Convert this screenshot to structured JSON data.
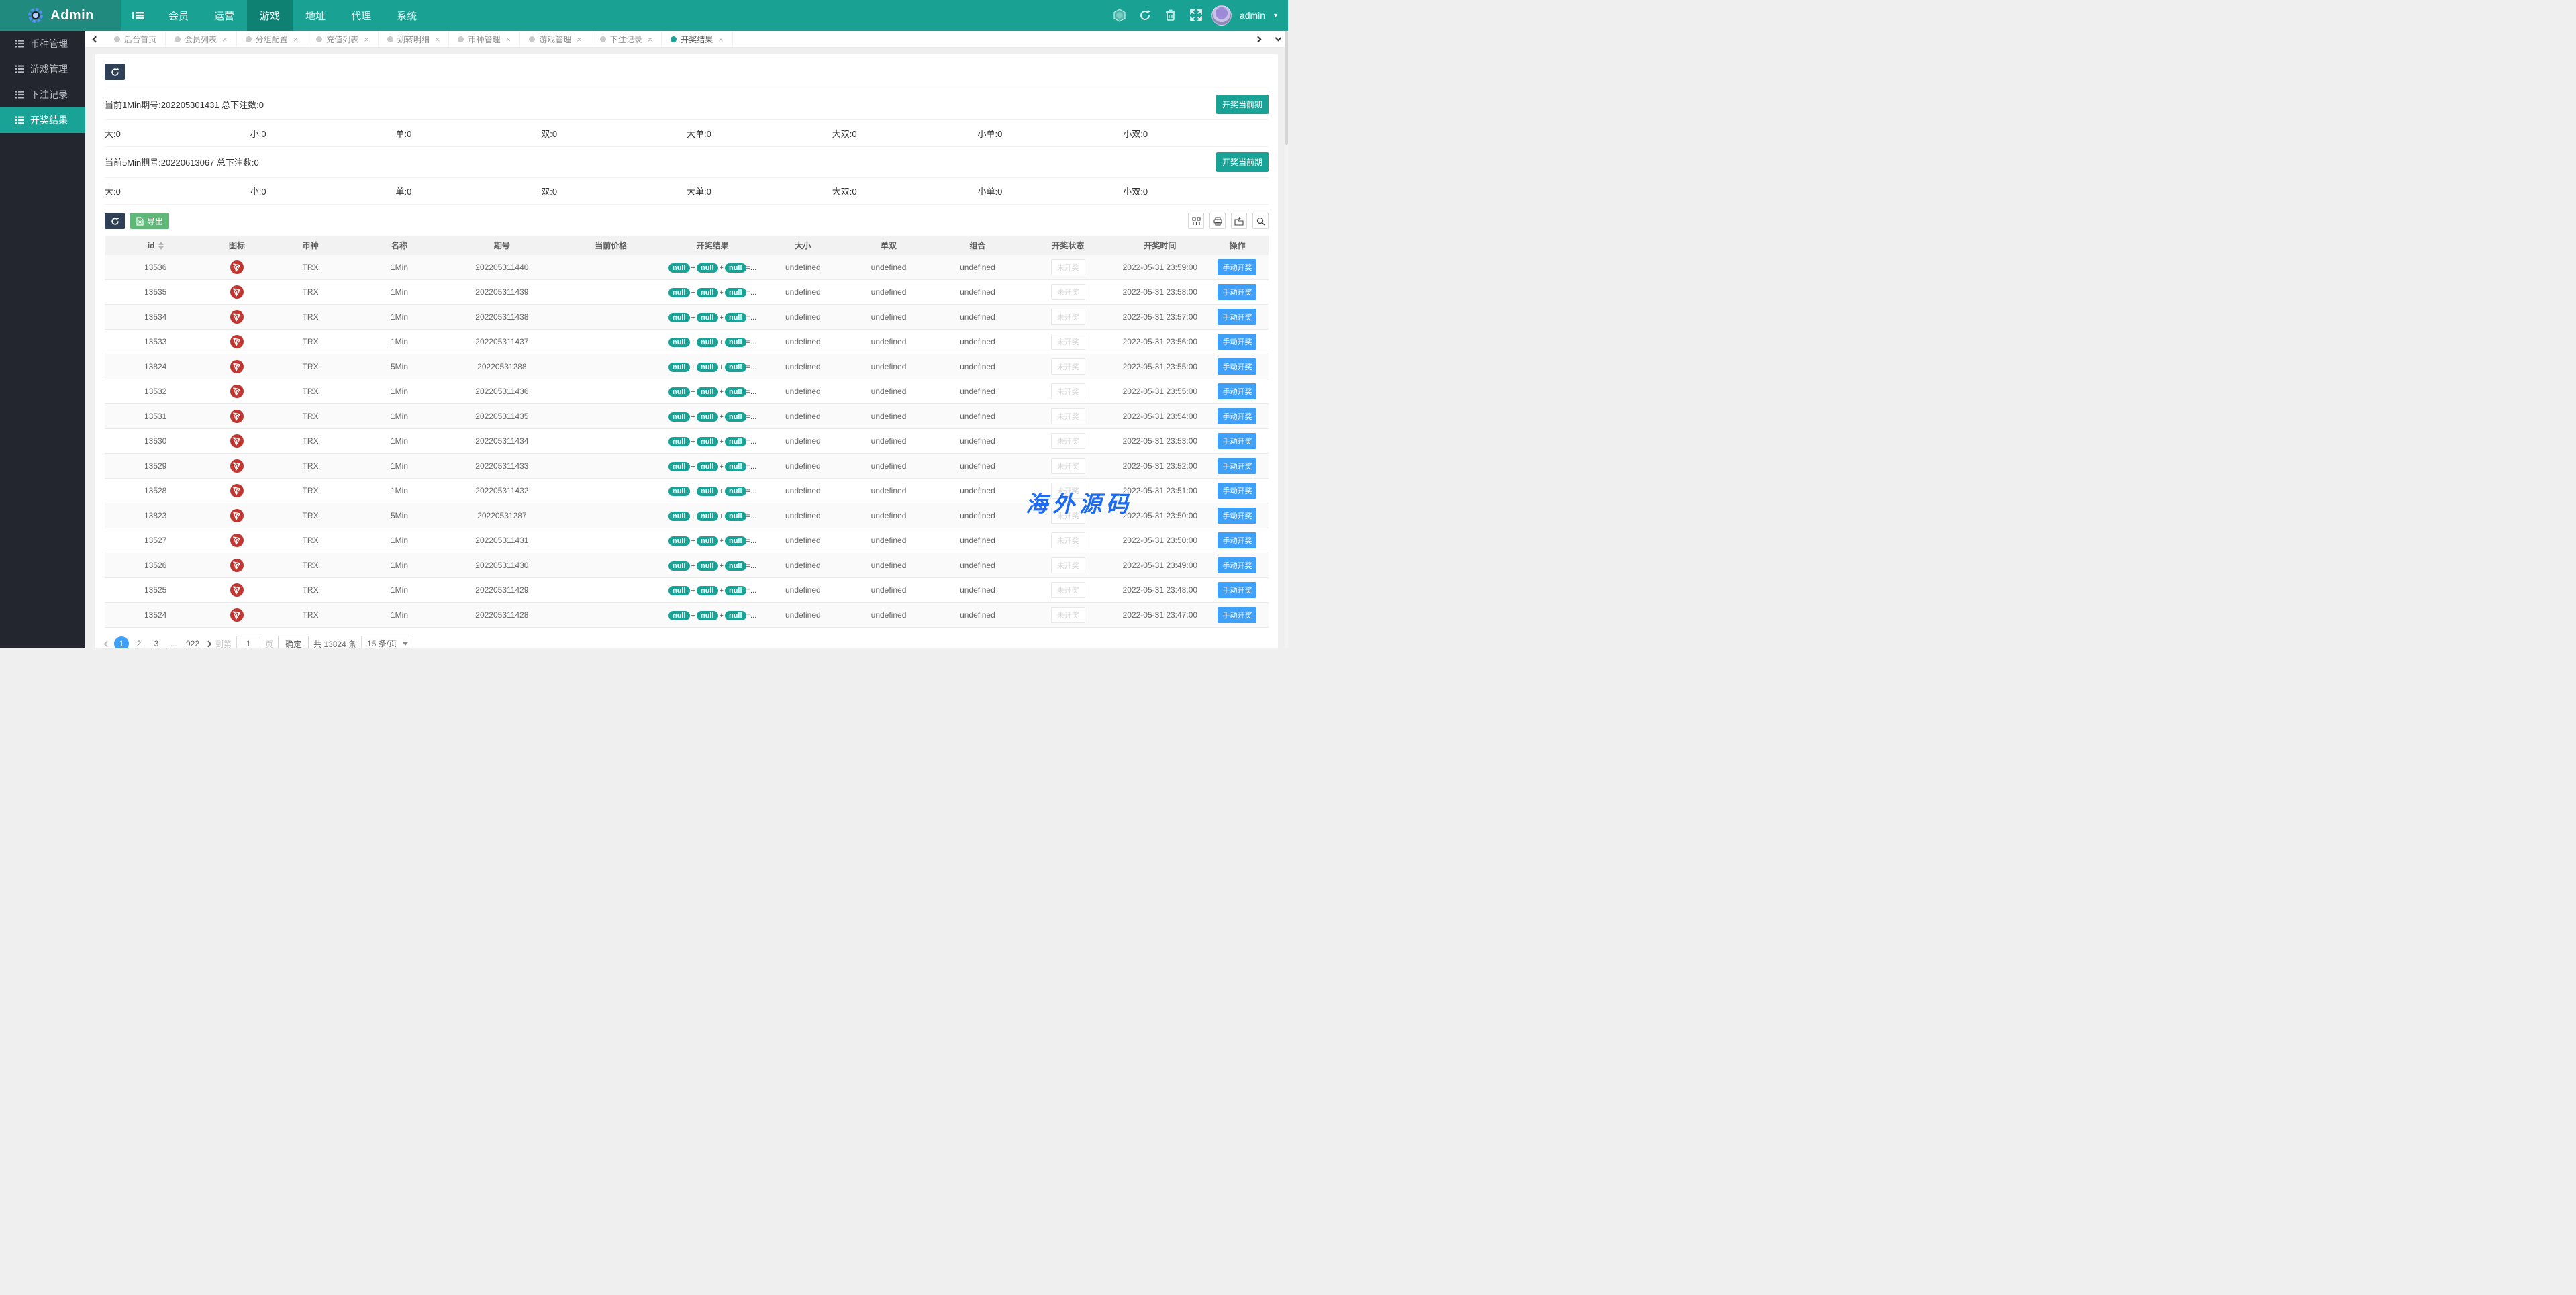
{
  "colors": {
    "theme_teal": "#18A396",
    "header_teal": "#19A294",
    "dark_button": "#2F4056",
    "green_button": "#5FB878",
    "blue_button": "#3FA0F8",
    "coin_red": "#C23631",
    "watermark_blue": "#1E6BF2"
  },
  "header": {
    "logo_text": "Admin",
    "nav": [
      {
        "label": "会员"
      },
      {
        "label": "运营"
      },
      {
        "label": "游戏",
        "active": true
      },
      {
        "label": "地址"
      },
      {
        "label": "代理"
      },
      {
        "label": "系统"
      }
    ],
    "icons": [
      "hexagon-badge",
      "refresh",
      "trash",
      "fullscreen"
    ],
    "username": "admin"
  },
  "sidebar": {
    "items": [
      {
        "label": "币种管理"
      },
      {
        "label": "游戏管理"
      },
      {
        "label": "下注记录"
      },
      {
        "label": "开奖结果",
        "active": true
      }
    ]
  },
  "tabs": {
    "items": [
      {
        "label": "后台首页",
        "closable": false
      },
      {
        "label": "会员列表",
        "closable": true
      },
      {
        "label": "分组配置",
        "closable": true
      },
      {
        "label": "充值列表",
        "closable": true
      },
      {
        "label": "划转明细",
        "closable": true
      },
      {
        "label": "币种管理",
        "closable": true
      },
      {
        "label": "游戏管理",
        "closable": true
      },
      {
        "label": "下注记录",
        "closable": true
      },
      {
        "label": "开奖结果",
        "closable": true,
        "active": true
      }
    ]
  },
  "sections": [
    {
      "title": "当前1Min期号:202205301431 总下注数:0",
      "button_label": "开奖当前期",
      "stats": [
        "大:0",
        "小:0",
        "单:0",
        "双:0",
        "大单:0",
        "大双:0",
        "小单:0",
        "小双:0"
      ]
    },
    {
      "title": "当前5Min期号:20220613067 总下注数:0",
      "button_label": "开奖当前期",
      "stats": [
        "大:0",
        "小:0",
        "单:0",
        "双:0",
        "大单:0",
        "大双:0",
        "小单:0",
        "小双:0"
      ]
    }
  ],
  "toolbar": {
    "export_label": "导出",
    "table_tools": [
      "layout-columns",
      "print",
      "export-file",
      "search"
    ]
  },
  "table": {
    "columns": [
      "id",
      "图标",
      "币种",
      "名称",
      "期号",
      "当前价格",
      "开奖结果",
      "大小",
      "单双",
      "组合",
      "开奖状态",
      "开奖时间",
      "操作"
    ],
    "rows": [
      {
        "id": "13536",
        "coin": "TRX",
        "name": "1Min",
        "issue": "202205311440",
        "price": "",
        "result": [
          "null",
          "null",
          "null"
        ],
        "result_suffix": "=...",
        "bigsmall": "undefined",
        "oddeven": "undefined",
        "combo": "undefined",
        "status": "未开奖",
        "time": "2022-05-31 23:59:00",
        "action": "手动开奖"
      },
      {
        "id": "13535",
        "coin": "TRX",
        "name": "1Min",
        "issue": "202205311439",
        "price": "",
        "result": [
          "null",
          "null",
          "null"
        ],
        "result_suffix": "=...",
        "bigsmall": "undefined",
        "oddeven": "undefined",
        "combo": "undefined",
        "status": "未开奖",
        "time": "2022-05-31 23:58:00",
        "action": "手动开奖"
      },
      {
        "id": "13534",
        "coin": "TRX",
        "name": "1Min",
        "issue": "202205311438",
        "price": "",
        "result": [
          "null",
          "null",
          "null"
        ],
        "result_suffix": "=...",
        "bigsmall": "undefined",
        "oddeven": "undefined",
        "combo": "undefined",
        "status": "未开奖",
        "time": "2022-05-31 23:57:00",
        "action": "手动开奖"
      },
      {
        "id": "13533",
        "coin": "TRX",
        "name": "1Min",
        "issue": "202205311437",
        "price": "",
        "result": [
          "null",
          "null",
          "null"
        ],
        "result_suffix": "=...",
        "bigsmall": "undefined",
        "oddeven": "undefined",
        "combo": "undefined",
        "status": "未开奖",
        "time": "2022-05-31 23:56:00",
        "action": "手动开奖"
      },
      {
        "id": "13824",
        "coin": "TRX",
        "name": "5Min",
        "issue": "20220531288",
        "price": "",
        "result": [
          "null",
          "null",
          "null"
        ],
        "result_suffix": "=...",
        "bigsmall": "undefined",
        "oddeven": "undefined",
        "combo": "undefined",
        "status": "未开奖",
        "time": "2022-05-31 23:55:00",
        "action": "手动开奖"
      },
      {
        "id": "13532",
        "coin": "TRX",
        "name": "1Min",
        "issue": "202205311436",
        "price": "",
        "result": [
          "null",
          "null",
          "null"
        ],
        "result_suffix": "=...",
        "bigsmall": "undefined",
        "oddeven": "undefined",
        "combo": "undefined",
        "status": "未开奖",
        "time": "2022-05-31 23:55:00",
        "action": "手动开奖"
      },
      {
        "id": "13531",
        "coin": "TRX",
        "name": "1Min",
        "issue": "202205311435",
        "price": "",
        "result": [
          "null",
          "null",
          "null"
        ],
        "result_suffix": "=...",
        "bigsmall": "undefined",
        "oddeven": "undefined",
        "combo": "undefined",
        "status": "未开奖",
        "time": "2022-05-31 23:54:00",
        "action": "手动开奖"
      },
      {
        "id": "13530",
        "coin": "TRX",
        "name": "1Min",
        "issue": "202205311434",
        "price": "",
        "result": [
          "null",
          "null",
          "null"
        ],
        "result_suffix": "=...",
        "bigsmall": "undefined",
        "oddeven": "undefined",
        "combo": "undefined",
        "status": "未开奖",
        "time": "2022-05-31 23:53:00",
        "action": "手动开奖"
      },
      {
        "id": "13529",
        "coin": "TRX",
        "name": "1Min",
        "issue": "202205311433",
        "price": "",
        "result": [
          "null",
          "null",
          "null"
        ],
        "result_suffix": "=...",
        "bigsmall": "undefined",
        "oddeven": "undefined",
        "combo": "undefined",
        "status": "未开奖",
        "time": "2022-05-31 23:52:00",
        "action": "手动开奖"
      },
      {
        "id": "13528",
        "coin": "TRX",
        "name": "1Min",
        "issue": "202205311432",
        "price": "",
        "result": [
          "null",
          "null",
          "null"
        ],
        "result_suffix": "=...",
        "bigsmall": "undefined",
        "oddeven": "undefined",
        "combo": "undefined",
        "status": "未开奖",
        "time": "2022-05-31 23:51:00",
        "action": "手动开奖"
      },
      {
        "id": "13823",
        "coin": "TRX",
        "name": "5Min",
        "issue": "20220531287",
        "price": "",
        "result": [
          "null",
          "null",
          "null"
        ],
        "result_suffix": "=...",
        "bigsmall": "undefined",
        "oddeven": "undefined",
        "combo": "undefined",
        "status": "未开奖",
        "time": "2022-05-31 23:50:00",
        "action": "手动开奖"
      },
      {
        "id": "13527",
        "coin": "TRX",
        "name": "1Min",
        "issue": "202205311431",
        "price": "",
        "result": [
          "null",
          "null",
          "null"
        ],
        "result_suffix": "=...",
        "bigsmall": "undefined",
        "oddeven": "undefined",
        "combo": "undefined",
        "status": "未开奖",
        "time": "2022-05-31 23:50:00",
        "action": "手动开奖"
      },
      {
        "id": "13526",
        "coin": "TRX",
        "name": "1Min",
        "issue": "202205311430",
        "price": "",
        "result": [
          "null",
          "null",
          "null"
        ],
        "result_suffix": "=...",
        "bigsmall": "undefined",
        "oddeven": "undefined",
        "combo": "undefined",
        "status": "未开奖",
        "time": "2022-05-31 23:49:00",
        "action": "手动开奖"
      },
      {
        "id": "13525",
        "coin": "TRX",
        "name": "1Min",
        "issue": "202205311429",
        "price": "",
        "result": [
          "null",
          "null",
          "null"
        ],
        "result_suffix": "=...",
        "bigsmall": "undefined",
        "oddeven": "undefined",
        "combo": "undefined",
        "status": "未开奖",
        "time": "2022-05-31 23:48:00",
        "action": "手动开奖"
      },
      {
        "id": "13524",
        "coin": "TRX",
        "name": "1Min",
        "issue": "202205311428",
        "price": "",
        "result": [
          "null",
          "null",
          "null"
        ],
        "result_suffix": "=...",
        "bigsmall": "undefined",
        "oddeven": "undefined",
        "combo": "undefined",
        "status": "未开奖",
        "time": "2022-05-31 23:47:00",
        "action": "手动开奖"
      }
    ]
  },
  "pagination": {
    "pages": [
      {
        "label": "1",
        "active": true
      },
      {
        "label": "2"
      },
      {
        "label": "3"
      },
      {
        "label": "...",
        "ellipsis": true
      },
      {
        "label": "922"
      }
    ],
    "goto_label": "到第",
    "goto_value": "1",
    "page_unit": "页",
    "confirm_label": "确定",
    "total_label": "共 13824 条",
    "per_page_label": "15 条/页"
  },
  "watermark": "海外源码"
}
